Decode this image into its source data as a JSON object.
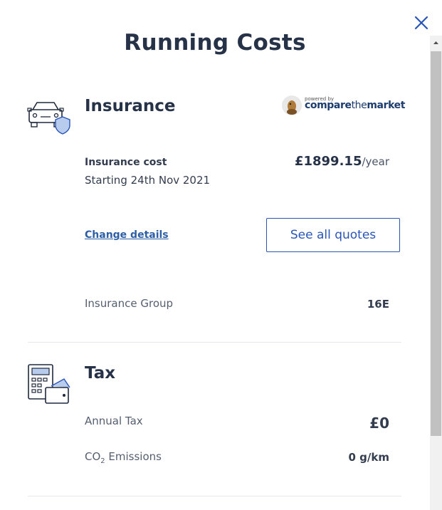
{
  "title": "Running Costs",
  "insurance": {
    "heading": "Insurance",
    "powered_by": "powered by",
    "partner_name_bold": "compare",
    "partner_name_light": "the",
    "partner_name_end": "market",
    "cost_label": "Insurance cost",
    "start_text": "Starting 24th Nov 2021",
    "price": "£1899.15",
    "price_unit": "/year",
    "change_details": "Change details",
    "see_quotes": "See all quotes",
    "group_label": "Insurance Group",
    "group_value": "16E"
  },
  "tax": {
    "heading": "Tax",
    "annual_label": "Annual Tax",
    "annual_value": "£0",
    "co2_label_prefix": "CO",
    "co2_label_sub": "2",
    "co2_label_suffix": " Emissions",
    "co2_value": "0 g/km"
  },
  "colors": {
    "accent": "#2a55b8",
    "heading": "#263248",
    "link": "#2d5fa6"
  },
  "icons": [
    "close-icon",
    "car-shield-icon",
    "calculator-wallet-icon",
    "scroll-up-arrow-icon"
  ]
}
